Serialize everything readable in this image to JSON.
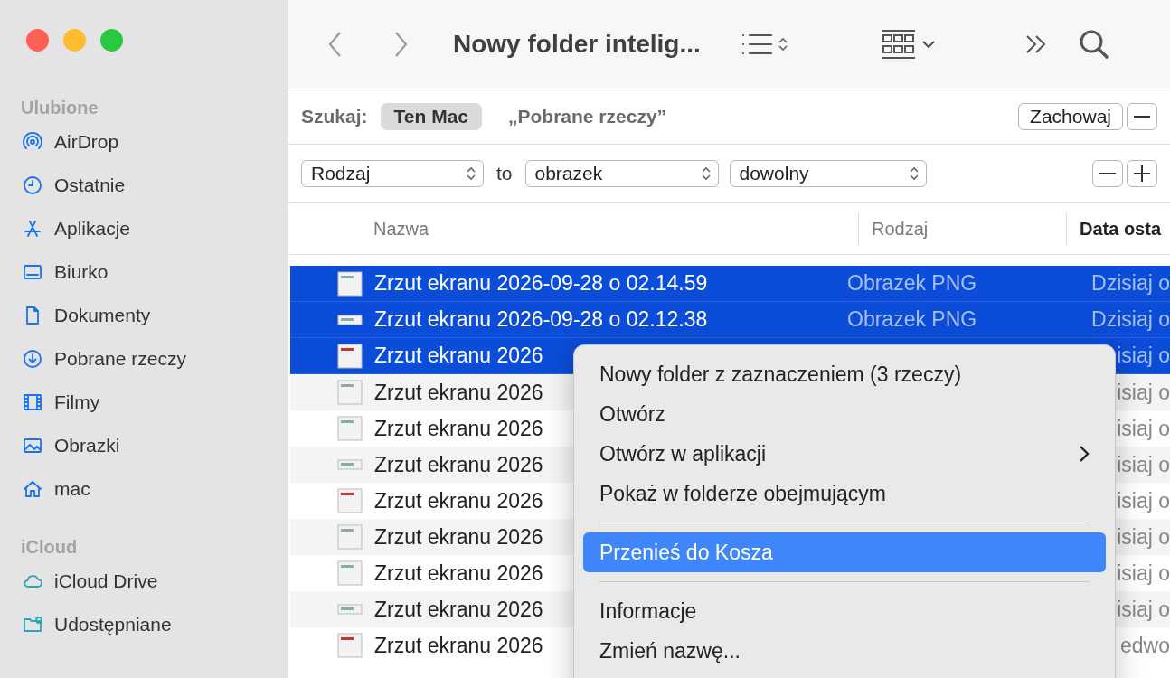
{
  "sidebar": {
    "sections": [
      {
        "title": "Ulubione",
        "items": [
          {
            "label": "AirDrop"
          },
          {
            "label": "Ostatnie"
          },
          {
            "label": "Aplikacje"
          },
          {
            "label": "Biurko"
          },
          {
            "label": "Dokumenty"
          },
          {
            "label": "Pobrane rzeczy"
          },
          {
            "label": "Filmy"
          },
          {
            "label": "Obrazki"
          },
          {
            "label": "mac"
          }
        ]
      },
      {
        "title": "iCloud",
        "items": [
          {
            "label": "iCloud Drive"
          },
          {
            "label": "Udostępniane"
          }
        ]
      }
    ]
  },
  "toolbar": {
    "title": "Nowy folder intelig..."
  },
  "search": {
    "label": "Szukaj:",
    "scopes": [
      {
        "label": "Ten Mac",
        "selected": true
      },
      {
        "label": "„Pobrane rzeczy”",
        "selected": false
      }
    ],
    "save_button": "Zachowaj"
  },
  "criteria": {
    "field": "Rodzaj",
    "operator": "to",
    "value": "obrazek",
    "qualifier": "dowolny"
  },
  "columns": [
    {
      "label": "Nazwa",
      "sorted": false
    },
    {
      "label": "Rodzaj",
      "sorted": false
    },
    {
      "label": "Data osta",
      "sorted": true
    }
  ],
  "rows": [
    {
      "name": "Zrzut ekranu 2026-09-28 o 02.14.59",
      "kind": "Obrazek PNG",
      "date": "Dzisiaj o",
      "selected": true
    },
    {
      "name": "Zrzut ekranu 2026-09-28 o 02.12.38",
      "kind": "Obrazek PNG",
      "date": "Dzisiaj o",
      "selected": true
    },
    {
      "name": "Zrzut ekranu 2026",
      "date": "isiaj o",
      "selected": true
    },
    {
      "name": "Zrzut ekranu 2026",
      "date": "isiaj o",
      "selected": false
    },
    {
      "name": "Zrzut ekranu 2026",
      "date": "isiaj o",
      "selected": false
    },
    {
      "name": "Zrzut ekranu 2026",
      "date": "isiaj o",
      "selected": false
    },
    {
      "name": "Zrzut ekranu 2026",
      "date": "isiaj o",
      "selected": false
    },
    {
      "name": "Zrzut ekranu 2026",
      "date": "isiaj o",
      "selected": false
    },
    {
      "name": "Zrzut ekranu 2026",
      "date": "isiaj o",
      "selected": false
    },
    {
      "name": "Zrzut ekranu 2026",
      "date": "isiaj o",
      "selected": false
    },
    {
      "name": "Zrzut ekranu 2026",
      "date": "edwo",
      "selected": false
    }
  ],
  "context_menu": [
    {
      "kind": "item",
      "label": "Nowy folder z zaznaczeniem (3 rzeczy)",
      "selected": false,
      "submenu": false
    },
    {
      "kind": "item",
      "label": "Otwórz",
      "selected": false,
      "submenu": false
    },
    {
      "kind": "item",
      "label": "Otwórz w aplikacji",
      "selected": false,
      "submenu": true
    },
    {
      "kind": "item",
      "label": "Pokaż w folderze obejmującym",
      "selected": false,
      "submenu": false
    },
    {
      "kind": "separator"
    },
    {
      "kind": "item",
      "label": "Przenieś do Kosza",
      "selected": true,
      "submenu": false
    },
    {
      "kind": "separator"
    },
    {
      "kind": "item",
      "label": "Informacje",
      "selected": false,
      "submenu": false
    },
    {
      "kind": "item",
      "label": "Zmień nazwę...",
      "selected": false,
      "submenu": false
    }
  ]
}
